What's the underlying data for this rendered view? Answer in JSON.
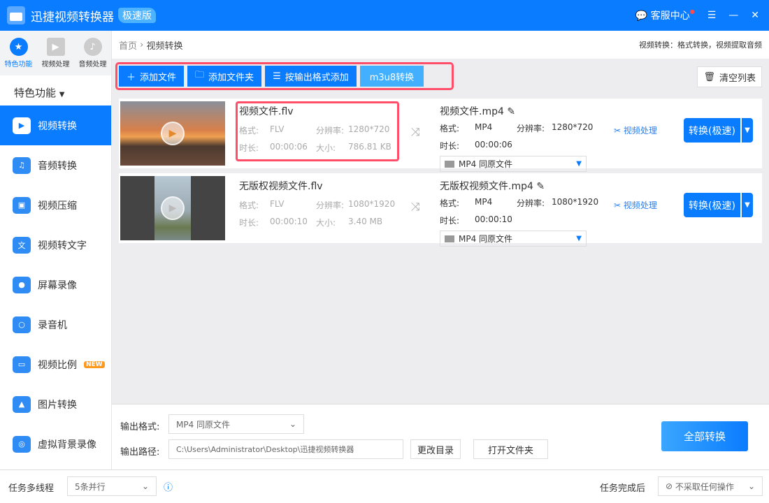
{
  "title": {
    "app": "迅捷视频转换器",
    "edition": "极速版",
    "support": "客服中心"
  },
  "sidebar": {
    "topcats": [
      {
        "label": "特色功能",
        "icon": "★"
      },
      {
        "label": "视频处理",
        "icon": "▶"
      },
      {
        "label": "音频处理",
        "icon": "♪"
      }
    ],
    "section": "特色功能",
    "items": [
      {
        "label": "视频转换",
        "icon": "▶"
      },
      {
        "label": "音频转换",
        "icon": "♫"
      },
      {
        "label": "视频压缩",
        "icon": "▣"
      },
      {
        "label": "视频转文字",
        "icon": "文"
      },
      {
        "label": "屏幕录像",
        "icon": "●"
      },
      {
        "label": "录音机",
        "icon": "○"
      },
      {
        "label": "视频比例",
        "icon": "▭",
        "badge": "NEW"
      },
      {
        "label": "图片转换",
        "icon": "▲"
      },
      {
        "label": "虚拟背景录像",
        "icon": "◎"
      }
    ]
  },
  "breadcrumb": {
    "home": "首页",
    "current": "视频转换",
    "hint": "视频转换：格式转换，视频提取音频"
  },
  "toolbar": {
    "add_file": "添加文件",
    "add_folder": "添加文件夹",
    "add_by_format": "按输出格式添加",
    "m3u8": "m3u8转换",
    "clear": "清空列表"
  },
  "labels": {
    "format": "格式:",
    "resolution": "分辨率:",
    "duration": "时长:",
    "size": "大小:",
    "video_process": "视频处理",
    "convert": "转换(极速)"
  },
  "files": [
    {
      "src": {
        "name": "视频文件.flv",
        "format": "FLV",
        "resolution": "1280*720",
        "duration": "00:00:06",
        "size": "786.81 KB"
      },
      "dst": {
        "name": "视频文件.mp4",
        "format": "MP4",
        "resolution": "1280*720",
        "duration": "00:00:06",
        "preset": "MP4  同原文件"
      }
    },
    {
      "src": {
        "name": "无版权视频文件.flv",
        "format": "FLV",
        "resolution": "1080*1920",
        "duration": "00:00:10",
        "size": "3.40 MB"
      },
      "dst": {
        "name": "无版权视频文件.mp4",
        "format": "MP4",
        "resolution": "1080*1920",
        "duration": "00:00:10",
        "preset": "MP4  同原文件"
      }
    }
  ],
  "bottom": {
    "format_label": "输出格式:",
    "format_value": "MP4  同原文件",
    "path_label": "输出路径:",
    "path_value": "C:\\Users\\Administrator\\Desktop\\迅捷视频转换器",
    "change_dir": "更改目录",
    "open_folder": "打开文件夹",
    "convert_all": "全部转换"
  },
  "status": {
    "threads_label": "任务多线程",
    "threads_value": "5条并行",
    "after_label": "任务完成后",
    "after_value": "不采取任何操作"
  }
}
